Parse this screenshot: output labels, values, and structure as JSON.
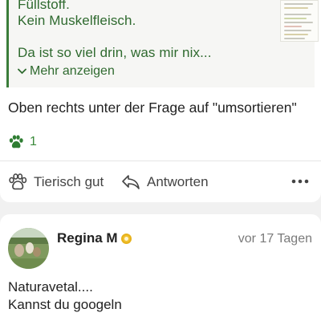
{
  "quoted_post": {
    "line1": "Füllstoff.",
    "line2": "Kein Muskelfleisch.",
    "line3": "Da ist so viel drin,  was mir nix...",
    "more_label": "Mehr anzeigen",
    "accent_color": "#2f6a2f"
  },
  "reply": {
    "text": "Oben rechts unter der Frage auf \"umsortieren\"",
    "paw_count": "1",
    "actions": {
      "like_label": "Tierisch gut",
      "reply_label": "Antworten"
    }
  },
  "comment": {
    "author": "Regina M",
    "timestamp": "vor 17 Tagen",
    "body_line1": "Naturavetal....",
    "body_line2": "Kannst du googeln"
  },
  "icons": {
    "paw": "paw-icon",
    "like": "paw-outline-icon",
    "reply": "reply-arrow-icon",
    "more": "more-dots-icon",
    "badge": "premium-badge-icon",
    "expand": "chevron-down-icon"
  }
}
